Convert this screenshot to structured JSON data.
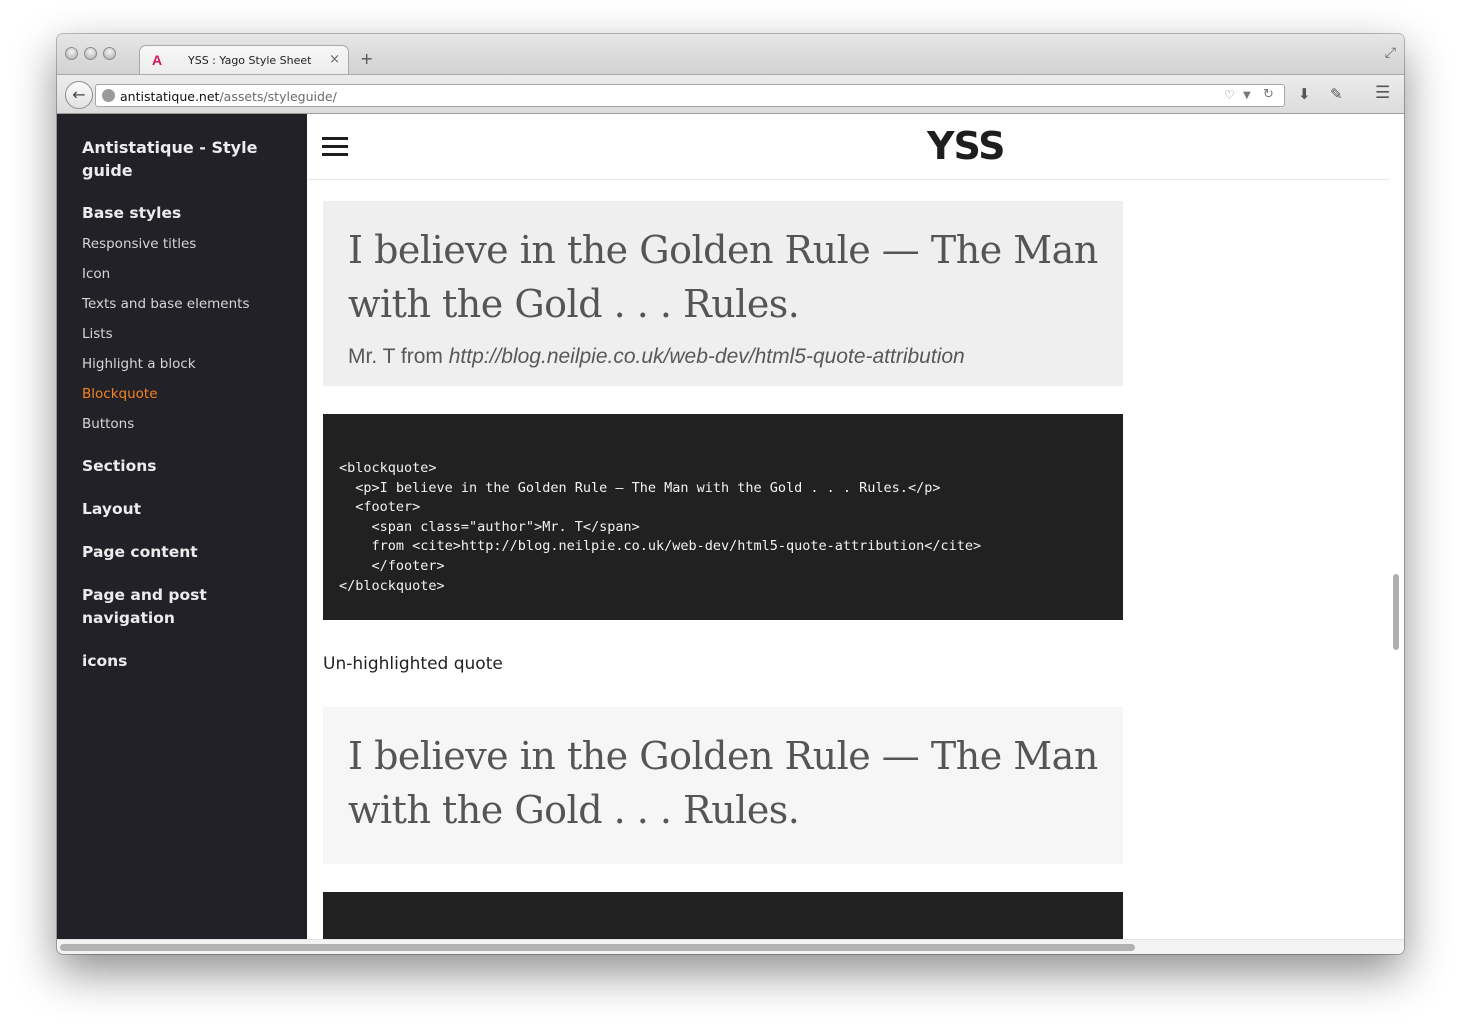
{
  "browser": {
    "tab_favicon": "A",
    "tab_title": "YSS : Yago Style Sheet",
    "tab_close": "×",
    "new_tab": "+",
    "url_domain": "antistatique.net",
    "url_path": "/assets/styleguide/",
    "icons": [
      "back-arrow-icon",
      "globe-icon",
      "pocket-icon",
      "dropdown-icon",
      "reload-icon",
      "download-icon",
      "tools-icon",
      "menu-icon",
      "fullscreen-icon"
    ]
  },
  "sidebar": {
    "brand": "Antistatique - Style guide",
    "sections": [
      {
        "label": "Base styles",
        "items": [
          {
            "label": "Responsive titles"
          },
          {
            "label": "Icon"
          },
          {
            "label": "Texts and base elements"
          },
          {
            "label": "Lists"
          },
          {
            "label": "Highlight a block"
          },
          {
            "label": "Blockquote",
            "active": true
          },
          {
            "label": "Buttons"
          }
        ]
      },
      {
        "label": "Sections"
      },
      {
        "label": "Layout"
      },
      {
        "label": "Page content"
      },
      {
        "label": "Page and post navigation"
      },
      {
        "label": "icons"
      }
    ],
    "active_color": "#f28322"
  },
  "header": {
    "logo": "YSS"
  },
  "content": {
    "quote1": {
      "text": "I believe in the Golden Rule — The Man with the Gold . . . Rules.",
      "author": "Mr. T",
      "from": " from ",
      "cite": "http://blog.neilpie.co.uk/web-dev/html5-quote-attribution"
    },
    "code1": "<blockquote>\n  <p>I believe in the Golden Rule – The Man with the Gold . . . Rules.</p>\n  <footer>\n    <span class=\"author\">Mr. T</span>\n    from <cite>http://blog.neilpie.co.uk/web-dev/html5-quote-attribution</cite>\n    </footer>\n</blockquote>",
    "label": "Un-highlighted quote",
    "quote2": {
      "text": "I believe in the Golden Rule — The Man with the Gold . . . Rules."
    },
    "code2": ""
  }
}
